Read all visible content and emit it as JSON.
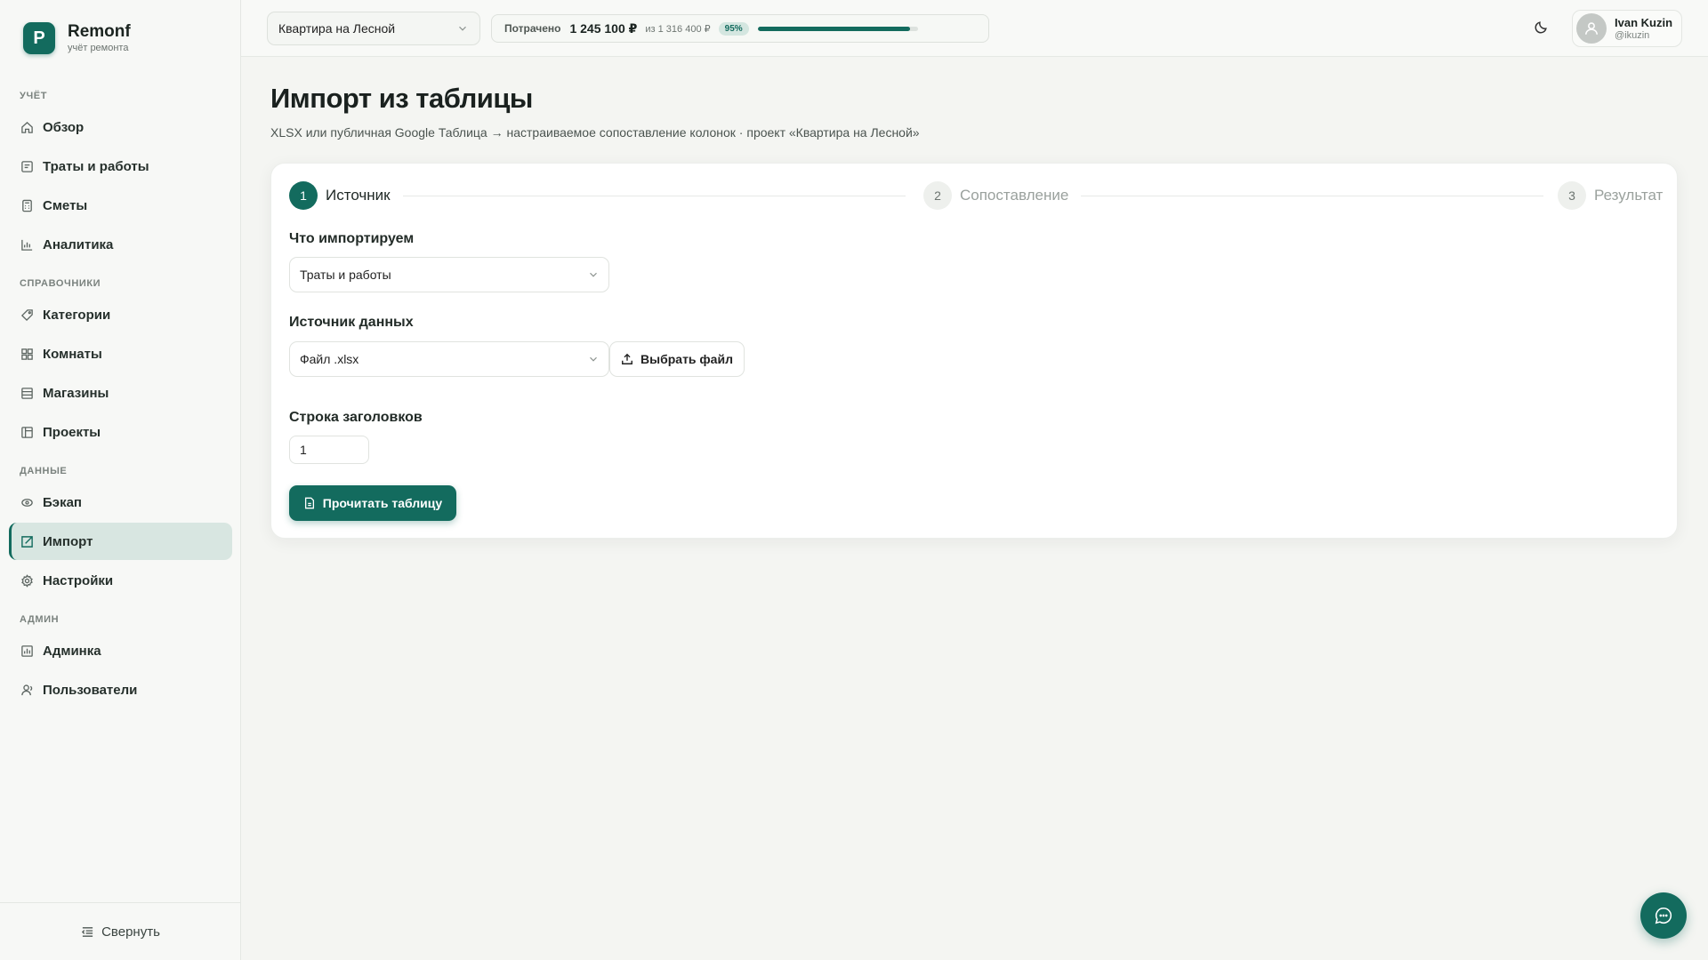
{
  "brand": {
    "logo_letter": "P",
    "name": "Remonf",
    "subtitle": "учёт ремонта"
  },
  "sidebar": {
    "sections": [
      {
        "title": "УЧЁТ",
        "items": [
          {
            "label": "Обзор",
            "icon": "home-icon"
          },
          {
            "label": "Траты и работы",
            "icon": "receipt-icon"
          },
          {
            "label": "Сметы",
            "icon": "calculator-icon"
          },
          {
            "label": "Аналитика",
            "icon": "bar-chart-icon"
          }
        ]
      },
      {
        "title": "СПРАВОЧНИКИ",
        "items": [
          {
            "label": "Категории",
            "icon": "tag-icon"
          },
          {
            "label": "Комнаты",
            "icon": "grid-icon"
          },
          {
            "label": "Магазины",
            "icon": "store-icon"
          },
          {
            "label": "Проекты",
            "icon": "kanban-icon"
          }
        ]
      },
      {
        "title": "ДАННЫЕ",
        "items": [
          {
            "label": "Бэкап",
            "icon": "backup-icon"
          },
          {
            "label": "Импорт",
            "icon": "import-icon",
            "active": true
          },
          {
            "label": "Настройки",
            "icon": "gear-icon"
          }
        ]
      },
      {
        "title": "АДМИН",
        "items": [
          {
            "label": "Админка",
            "icon": "admin-icon"
          },
          {
            "label": "Пользователи",
            "icon": "users-icon"
          }
        ]
      }
    ],
    "collapse_label": "Свернуть"
  },
  "topbar": {
    "project": "Квартира на Лесной",
    "budget_label": "Потрачено",
    "budget_spent": "1 245 100 ₽",
    "budget_total": "из 1 316 400 ₽",
    "budget_percent_label": "95%",
    "budget_fraction": 0.95,
    "user_name": "Ivan Kuzin",
    "user_handle": "@ikuzin"
  },
  "page": {
    "title": "Импорт из таблицы",
    "subtitle": "XLSX или публичная Google Таблица → настраиваемое сопоставление колонок · проект «Квартира на Лесной»"
  },
  "wizard": {
    "steps": [
      {
        "num": "1",
        "label": "Источник",
        "active": true
      },
      {
        "num": "2",
        "label": "Сопоставление",
        "active": false
      },
      {
        "num": "3",
        "label": "Результат",
        "active": false
      }
    ],
    "import_type_label": "Что импортируем",
    "import_type_value": "Траты и работы",
    "source_label": "Источник данных",
    "source_value": "Файл .xlsx",
    "choose_file_label": "Выбрать файл",
    "header_row_label": "Строка заголовков",
    "header_row_value": "1",
    "read_button_label": "Прочитать таблицу"
  },
  "colors": {
    "accent": "#136b5e",
    "active_bg": "#d8e6e1"
  }
}
